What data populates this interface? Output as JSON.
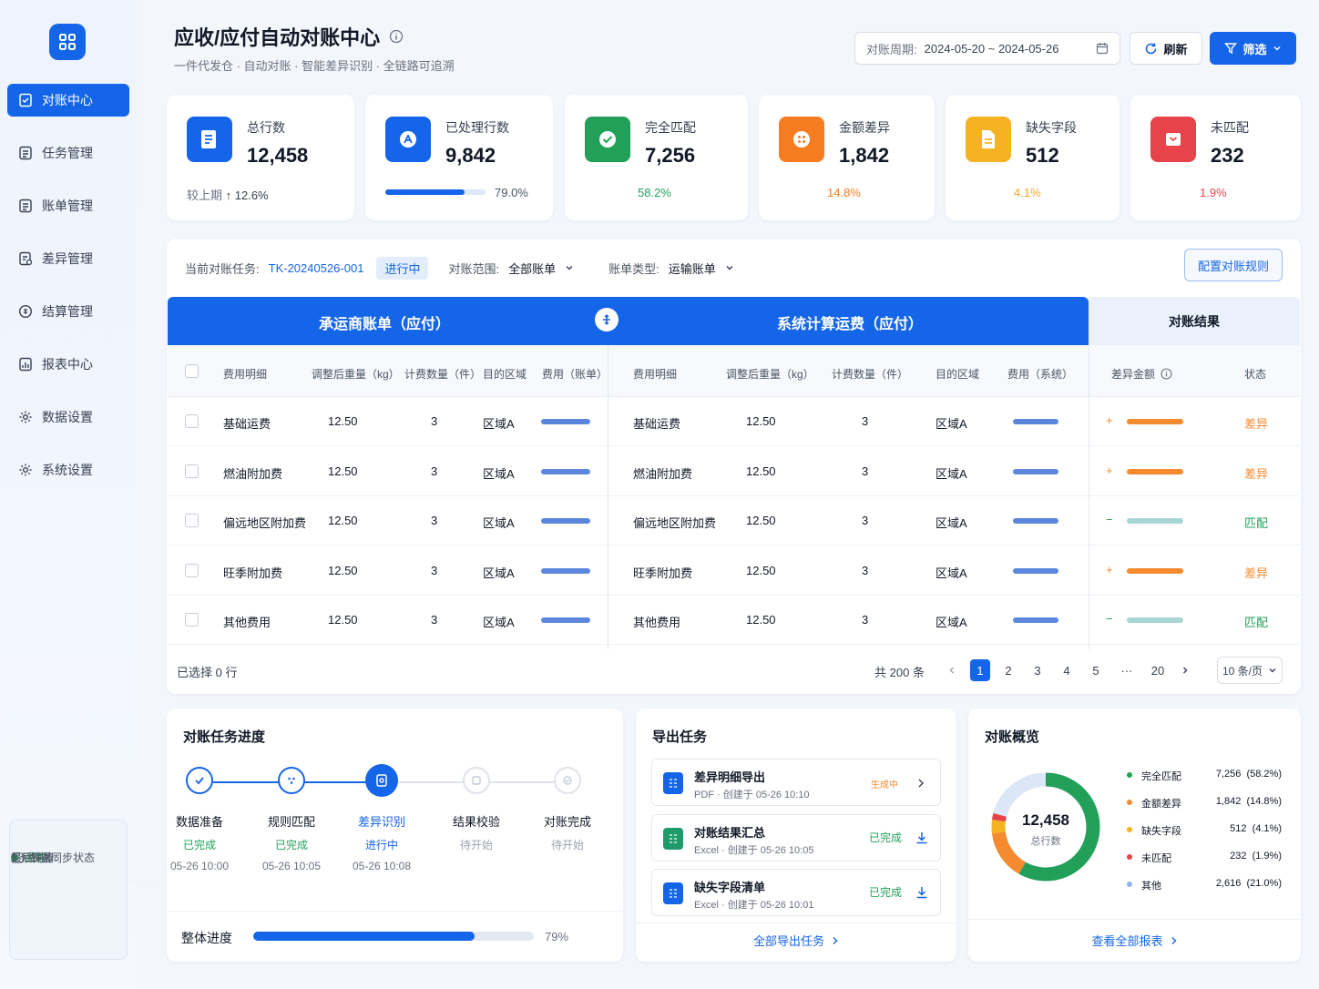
{
  "nav": {
    "items": [
      {
        "label": "对账中心",
        "active": true
      },
      {
        "label": "任务管理"
      },
      {
        "label": "账单管理"
      },
      {
        "label": "差异管理"
      },
      {
        "label": "结算管理"
      },
      {
        "label": "报表中心"
      },
      {
        "label": "数据设置"
      },
      {
        "label": "系统设置"
      }
    ]
  },
  "sync": {
    "title": "数据同步状态",
    "status": "正常",
    "last_label": "最后同步:",
    "last_value": "1 分钟前"
  },
  "header": {
    "title": "应收/应付自动对账中心",
    "subtitle": "一件代发仓 · 自动对账 · 智能差异识别 · 全链路可追溯",
    "period_label": "对账周期:",
    "period_value": "2024-05-20 ~ 2024-05-26",
    "refresh": "刷新",
    "filter": "筛选"
  },
  "stats": [
    {
      "label": "总行数",
      "value": "12,458",
      "foot_prefix": "较上期",
      "foot": "↑ 12.6%",
      "color": "#1565e8"
    },
    {
      "label": "已处理行数",
      "value": "9,842",
      "foot": "79.0%",
      "progress": 0.79,
      "color": "#1565e8"
    },
    {
      "label": "完全匹配",
      "value": "7,256",
      "foot": "58.2%",
      "color": "#22a05a"
    },
    {
      "label": "金额差异",
      "value": "1,842",
      "foot": "14.8%",
      "color": "#f57c20"
    },
    {
      "label": "缺失字段",
      "value": "512",
      "foot": "4.1%",
      "color": "#f5a623"
    },
    {
      "label": "未匹配",
      "value": "232",
      "foot": "1.9%",
      "color": "#e8424a"
    }
  ],
  "toolbar": {
    "task_label": "当前对账任务:",
    "task_id": "TK-20240526-001",
    "task_status": "进行中",
    "scope_label": "对账范围:",
    "scope_value": "全部账单",
    "type_label": "账单类型:",
    "type_value": "运输账单",
    "config_btn": "配置对账规则"
  },
  "table": {
    "band_left": "承运商账单（应付）",
    "band_mid": "系统计算运费（应付）",
    "band_right": "对账结果",
    "headers_left": [
      "费用明细",
      "调整后重量（kg）",
      "计费数量（件）",
      "目的区域",
      "费用（账单）"
    ],
    "headers_mid": [
      "费用明细",
      "调整后重量（kg）",
      "计费数量（件）",
      "目的区域",
      "费用（系统）"
    ],
    "headers_right": [
      "差异金额",
      "状态"
    ],
    "rows": [
      {
        "item": "基础运费",
        "weight": "12.50",
        "qty": "3",
        "region": "区域A",
        "sign": "+",
        "status": "差异"
      },
      {
        "item": "燃油附加费",
        "weight": "12.50",
        "qty": "3",
        "region": "区域A",
        "sign": "+",
        "status": "差异"
      },
      {
        "item": "偏远地区附加费",
        "weight": "12.50",
        "qty": "3",
        "region": "区域A",
        "sign": "−",
        "status": "匹配"
      },
      {
        "item": "旺季附加费",
        "weight": "12.50",
        "qty": "3",
        "region": "区域A",
        "sign": "+",
        "status": "差异"
      },
      {
        "item": "其他费用",
        "weight": "12.50",
        "qty": "3",
        "region": "区域A",
        "sign": "−",
        "status": "匹配"
      }
    ],
    "selected": "已选择 0 行",
    "total": "共 200 条",
    "pages": [
      "1",
      "2",
      "3",
      "4",
      "5",
      "···",
      "20"
    ],
    "page_size": "10 条/页"
  },
  "progress": {
    "title": "对账任务进度",
    "steps": [
      {
        "name": "数据准备",
        "status": "已完成",
        "time": "05-26 10:00"
      },
      {
        "name": "规则匹配",
        "status": "已完成",
        "time": "05-26 10:05"
      },
      {
        "name": "差异识别",
        "status": "进行中",
        "time": "05-26 10:08"
      },
      {
        "name": "结果校验",
        "status": "待开始",
        "time": ""
      },
      {
        "name": "对账完成",
        "status": "待开始",
        "time": ""
      }
    ],
    "overall_label": "整体进度",
    "overall_value": "79%",
    "overall": 0.79
  },
  "exports": {
    "title": "导出任务",
    "items": [
      {
        "name": "差异明细导出",
        "type": "PDF",
        "created": "创建于 05-26 10:10",
        "status": "生成中"
      },
      {
        "name": "对账结果汇总",
        "type": "Excel",
        "created": "创建于 05-26 10:05",
        "status": "已完成"
      },
      {
        "name": "缺失字段清单",
        "type": "Excel",
        "created": "创建于 05-26 10:01",
        "status": "已完成"
      }
    ],
    "all_link": "全部导出任务"
  },
  "overview": {
    "title": "对账概览",
    "center_value": "12,458",
    "center_label": "总行数",
    "link": "查看全部报表",
    "legend": [
      {
        "name": "完全匹配",
        "value": "7,256",
        "pct": "(58.2%)",
        "color": "#22a05a",
        "share": 0.582
      },
      {
        "name": "金额差异",
        "value": "1,842",
        "pct": "(14.8%)",
        "color": "#f58a2e",
        "share": 0.148
      },
      {
        "name": "缺失字段",
        "value": "512",
        "pct": "(4.1%)",
        "color": "#f5b323",
        "share": 0.041
      },
      {
        "name": "未匹配",
        "value": "232",
        "pct": "(1.9%)",
        "color": "#e8424a",
        "share": 0.019
      },
      {
        "name": "其他",
        "value": "2,616",
        "pct": "(21.0%)",
        "color": "#8fb3ec",
        "share": 0.21
      }
    ]
  }
}
